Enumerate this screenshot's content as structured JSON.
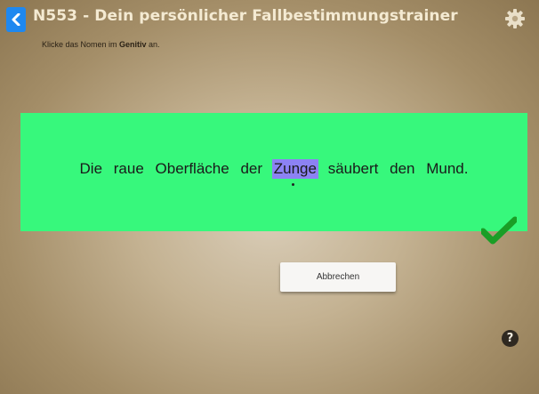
{
  "header": {
    "title": "N553 - Dein persönlicher Fallbestimmungstrainer",
    "back_icon": "chevron-left-icon",
    "settings_icon": "gear-icon"
  },
  "instruction": {
    "prefix": "Klicke das Nomen im ",
    "emphasis": "Genitiv",
    "suffix": " an."
  },
  "exercise": {
    "words": [
      "Die",
      "raue",
      "Oberfläche",
      "der",
      "Zunge",
      "säubert",
      "den",
      "Mund."
    ],
    "selected_index": 4,
    "result_icon": "checkmark-icon",
    "colors": {
      "panel": "#37f87c",
      "selection": "#8c82f3",
      "check": "#1a9e26"
    }
  },
  "actions": {
    "cancel_label": "Abbrechen",
    "help_label": "?"
  }
}
